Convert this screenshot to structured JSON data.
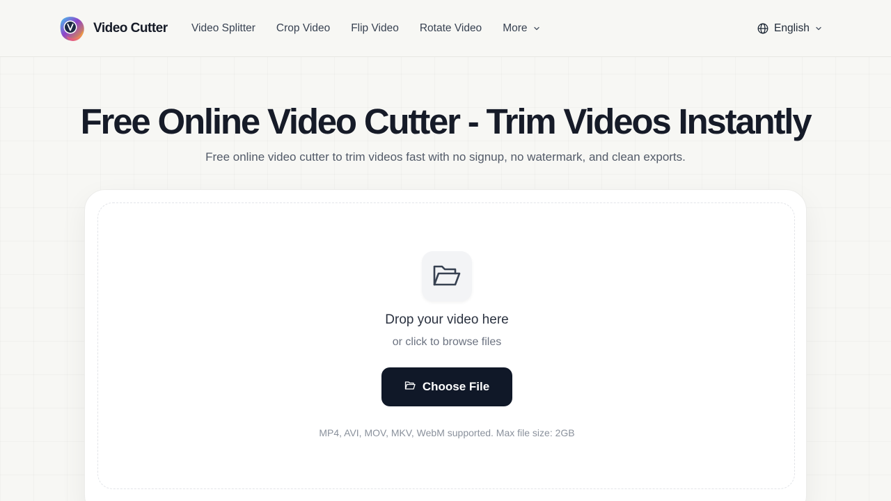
{
  "header": {
    "brand": "Video Cutter",
    "nav": [
      {
        "label": "Video Splitter"
      },
      {
        "label": "Crop Video"
      },
      {
        "label": "Flip Video"
      },
      {
        "label": "Rotate Video"
      },
      {
        "label": "More"
      }
    ],
    "language": "English",
    "icons": {
      "logo": "video-cutter-logo",
      "more": "chevron-down-icon",
      "language": "globe-icon",
      "language_menu": "chevron-down-icon"
    }
  },
  "hero": {
    "title": "Free Online Video Cutter - Trim Videos Instantly",
    "subtitle": "Free online video cutter to trim videos fast with no signup, no watermark, and clean exports."
  },
  "upload": {
    "drop_title": "Drop your video here",
    "drop_subtitle": "or click to browse files",
    "button_label": "Choose File",
    "formats": "MP4, AVI, MOV, MKV, WebM supported. Max file size: 2GB",
    "icons": {
      "drop": "folder-open-icon",
      "button": "folder-icon"
    }
  },
  "colors": {
    "background": "#f7f7f4",
    "button": "#101828",
    "title": "#161b28",
    "logo_gradient": [
      "#4fc3f7",
      "#8e44ad",
      "#f39c12"
    ]
  }
}
